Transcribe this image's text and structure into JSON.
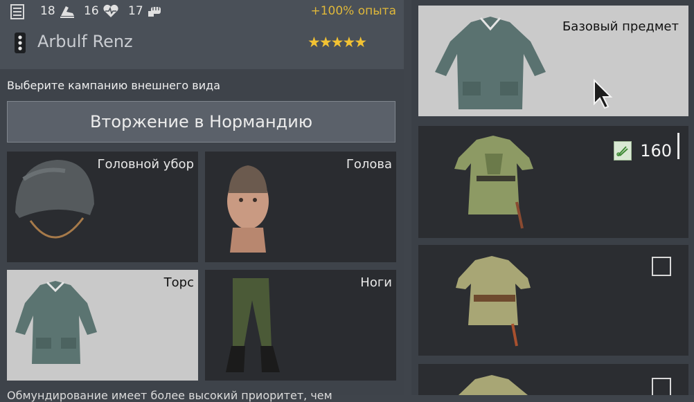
{
  "header": {
    "stats": [
      {
        "value": "18",
        "icon": "boot-icon"
      },
      {
        "value": "16",
        "icon": "heart-icon"
      },
      {
        "value": "17",
        "icon": "fist-icon"
      }
    ],
    "xp_bonus": "+100% опыта",
    "soldier_name": "Arbulf Renz",
    "rating_stars": 5
  },
  "appearance": {
    "caption": "Выберите кампанию внешнего вида",
    "campaign": "Вторжение в Нормандию",
    "slots": [
      {
        "label": "Головной убор"
      },
      {
        "label": "Голова"
      },
      {
        "label": "Торс"
      },
      {
        "label": "Ноги"
      }
    ],
    "footer_text": "Обмундирование имеет более высокий приоритет, чем"
  },
  "items": {
    "base_label": "Базовый предмет",
    "price_value": "160"
  },
  "colors": {
    "accent_xp": "#e0b83a",
    "stars": "#f2c233",
    "selected_bg": "#c9c9c9"
  }
}
